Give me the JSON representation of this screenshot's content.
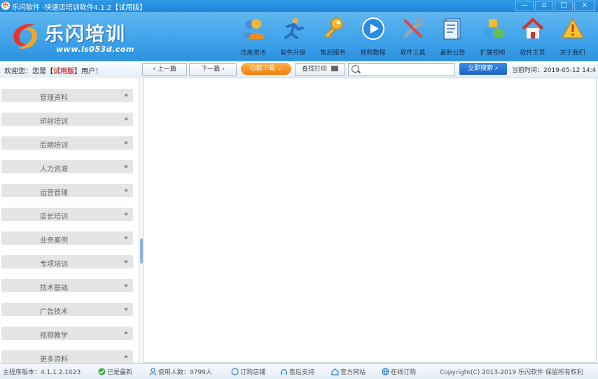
{
  "window": {
    "title": "乐闪软件 -快速店培训软件4.1.2【试用版】",
    "buttons": [
      "—",
      "▫",
      "□",
      "×"
    ]
  },
  "logo": {
    "name": "乐闪培训",
    "url": "www.ls053d.com"
  },
  "tools": [
    {
      "label": "注册激活",
      "icon": "user-group-icon"
    },
    {
      "label": "软件升级",
      "icon": "runner-icon"
    },
    {
      "label": "售后服务",
      "icon": "key-icon"
    },
    {
      "label": "视频教程",
      "icon": "play-icon"
    },
    {
      "label": "软件工具",
      "icon": "tools-icon"
    },
    {
      "label": "最新公告",
      "icon": "notice-icon"
    },
    {
      "label": "扩展视频",
      "icon": "cubes-icon"
    },
    {
      "label": "软件主页",
      "icon": "home-icon"
    },
    {
      "label": "关于我们",
      "icon": "warning-icon"
    }
  ],
  "toolbar": {
    "welcome_prefix": "欢迎您：您是【",
    "edition": "试用版",
    "welcome_suffix": "】用户！",
    "prev": "上一篇",
    "next": "下一篇",
    "dropdown": "功能下载",
    "print": "查找打印",
    "search_placeholder": "",
    "search_button": "立即搜索",
    "time": "当前时间：2019-05-12 14:4"
  },
  "sidebar": {
    "items": [
      "管理资料",
      "印前培训",
      "后期培训",
      "人力资源",
      "运营管理",
      "店长培训",
      "业务案例",
      "专项培训",
      "技术基础",
      "广告技术",
      "视频教学",
      "更多资料"
    ]
  },
  "status": {
    "version": "主程序版本：4.1.1.2.1023",
    "latest": "已是最新",
    "users": "使用人数：9799人",
    "order": "订购店铺",
    "support": "售后支持",
    "website": "官方网站",
    "online": "在线订购",
    "copyright": "Copyright(C) 2013-2019 乐闪软件 保留所有权利"
  },
  "colors": {
    "header": "#3ea2ea",
    "titlebar": "#1c86d8",
    "edition": "#e03a3a",
    "orange": "#f07d0a",
    "search_button": "#1b62c2"
  }
}
